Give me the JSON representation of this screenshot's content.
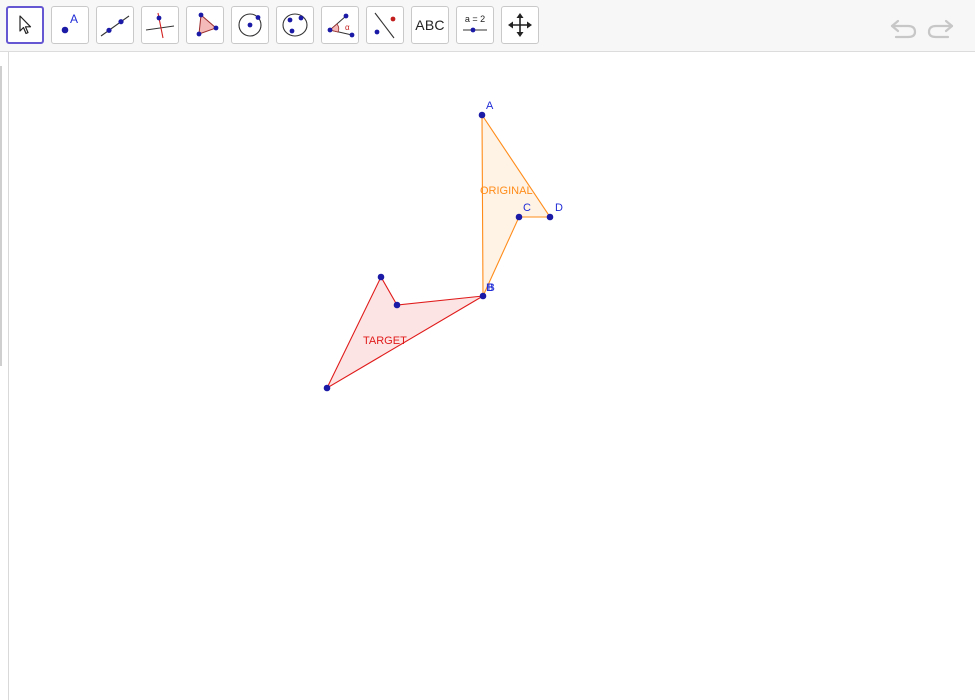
{
  "toolbar": {
    "tools": [
      {
        "name": "move-tool",
        "label": ""
      },
      {
        "name": "point-tool",
        "label": "A"
      },
      {
        "name": "line-tool",
        "label": ""
      },
      {
        "name": "perpendicular-line-tool",
        "label": ""
      },
      {
        "name": "polygon-tool",
        "label": ""
      },
      {
        "name": "circle-tool",
        "label": ""
      },
      {
        "name": "circle-through-points-tool",
        "label": ""
      },
      {
        "name": "angle-tool",
        "label": "α"
      },
      {
        "name": "reflect-about-line-tool",
        "label": ""
      },
      {
        "name": "text-tool",
        "label": "ABC"
      },
      {
        "name": "slider-tool",
        "label": "a = 2"
      },
      {
        "name": "move-graphics-view-tool",
        "label": ""
      }
    ],
    "undo_icon": "undo-icon",
    "redo_icon": "redo-icon"
  },
  "graphics": {
    "point_labels": {
      "A": "A",
      "B": "B",
      "C": "C",
      "D": "D",
      "B2": "B"
    },
    "polygon_labels": {
      "original": "ORIGINAL",
      "target": "TARGET"
    },
    "colors": {
      "original_stroke": "#ff8c1a",
      "original_fill": "#fff3e6",
      "target_stroke": "#e01b1b",
      "target_fill": "#fde4e4",
      "point_fill": "#1a1aa6",
      "label_blue": "#1f2bd6",
      "selected_tool_border": "#6557d2"
    }
  }
}
